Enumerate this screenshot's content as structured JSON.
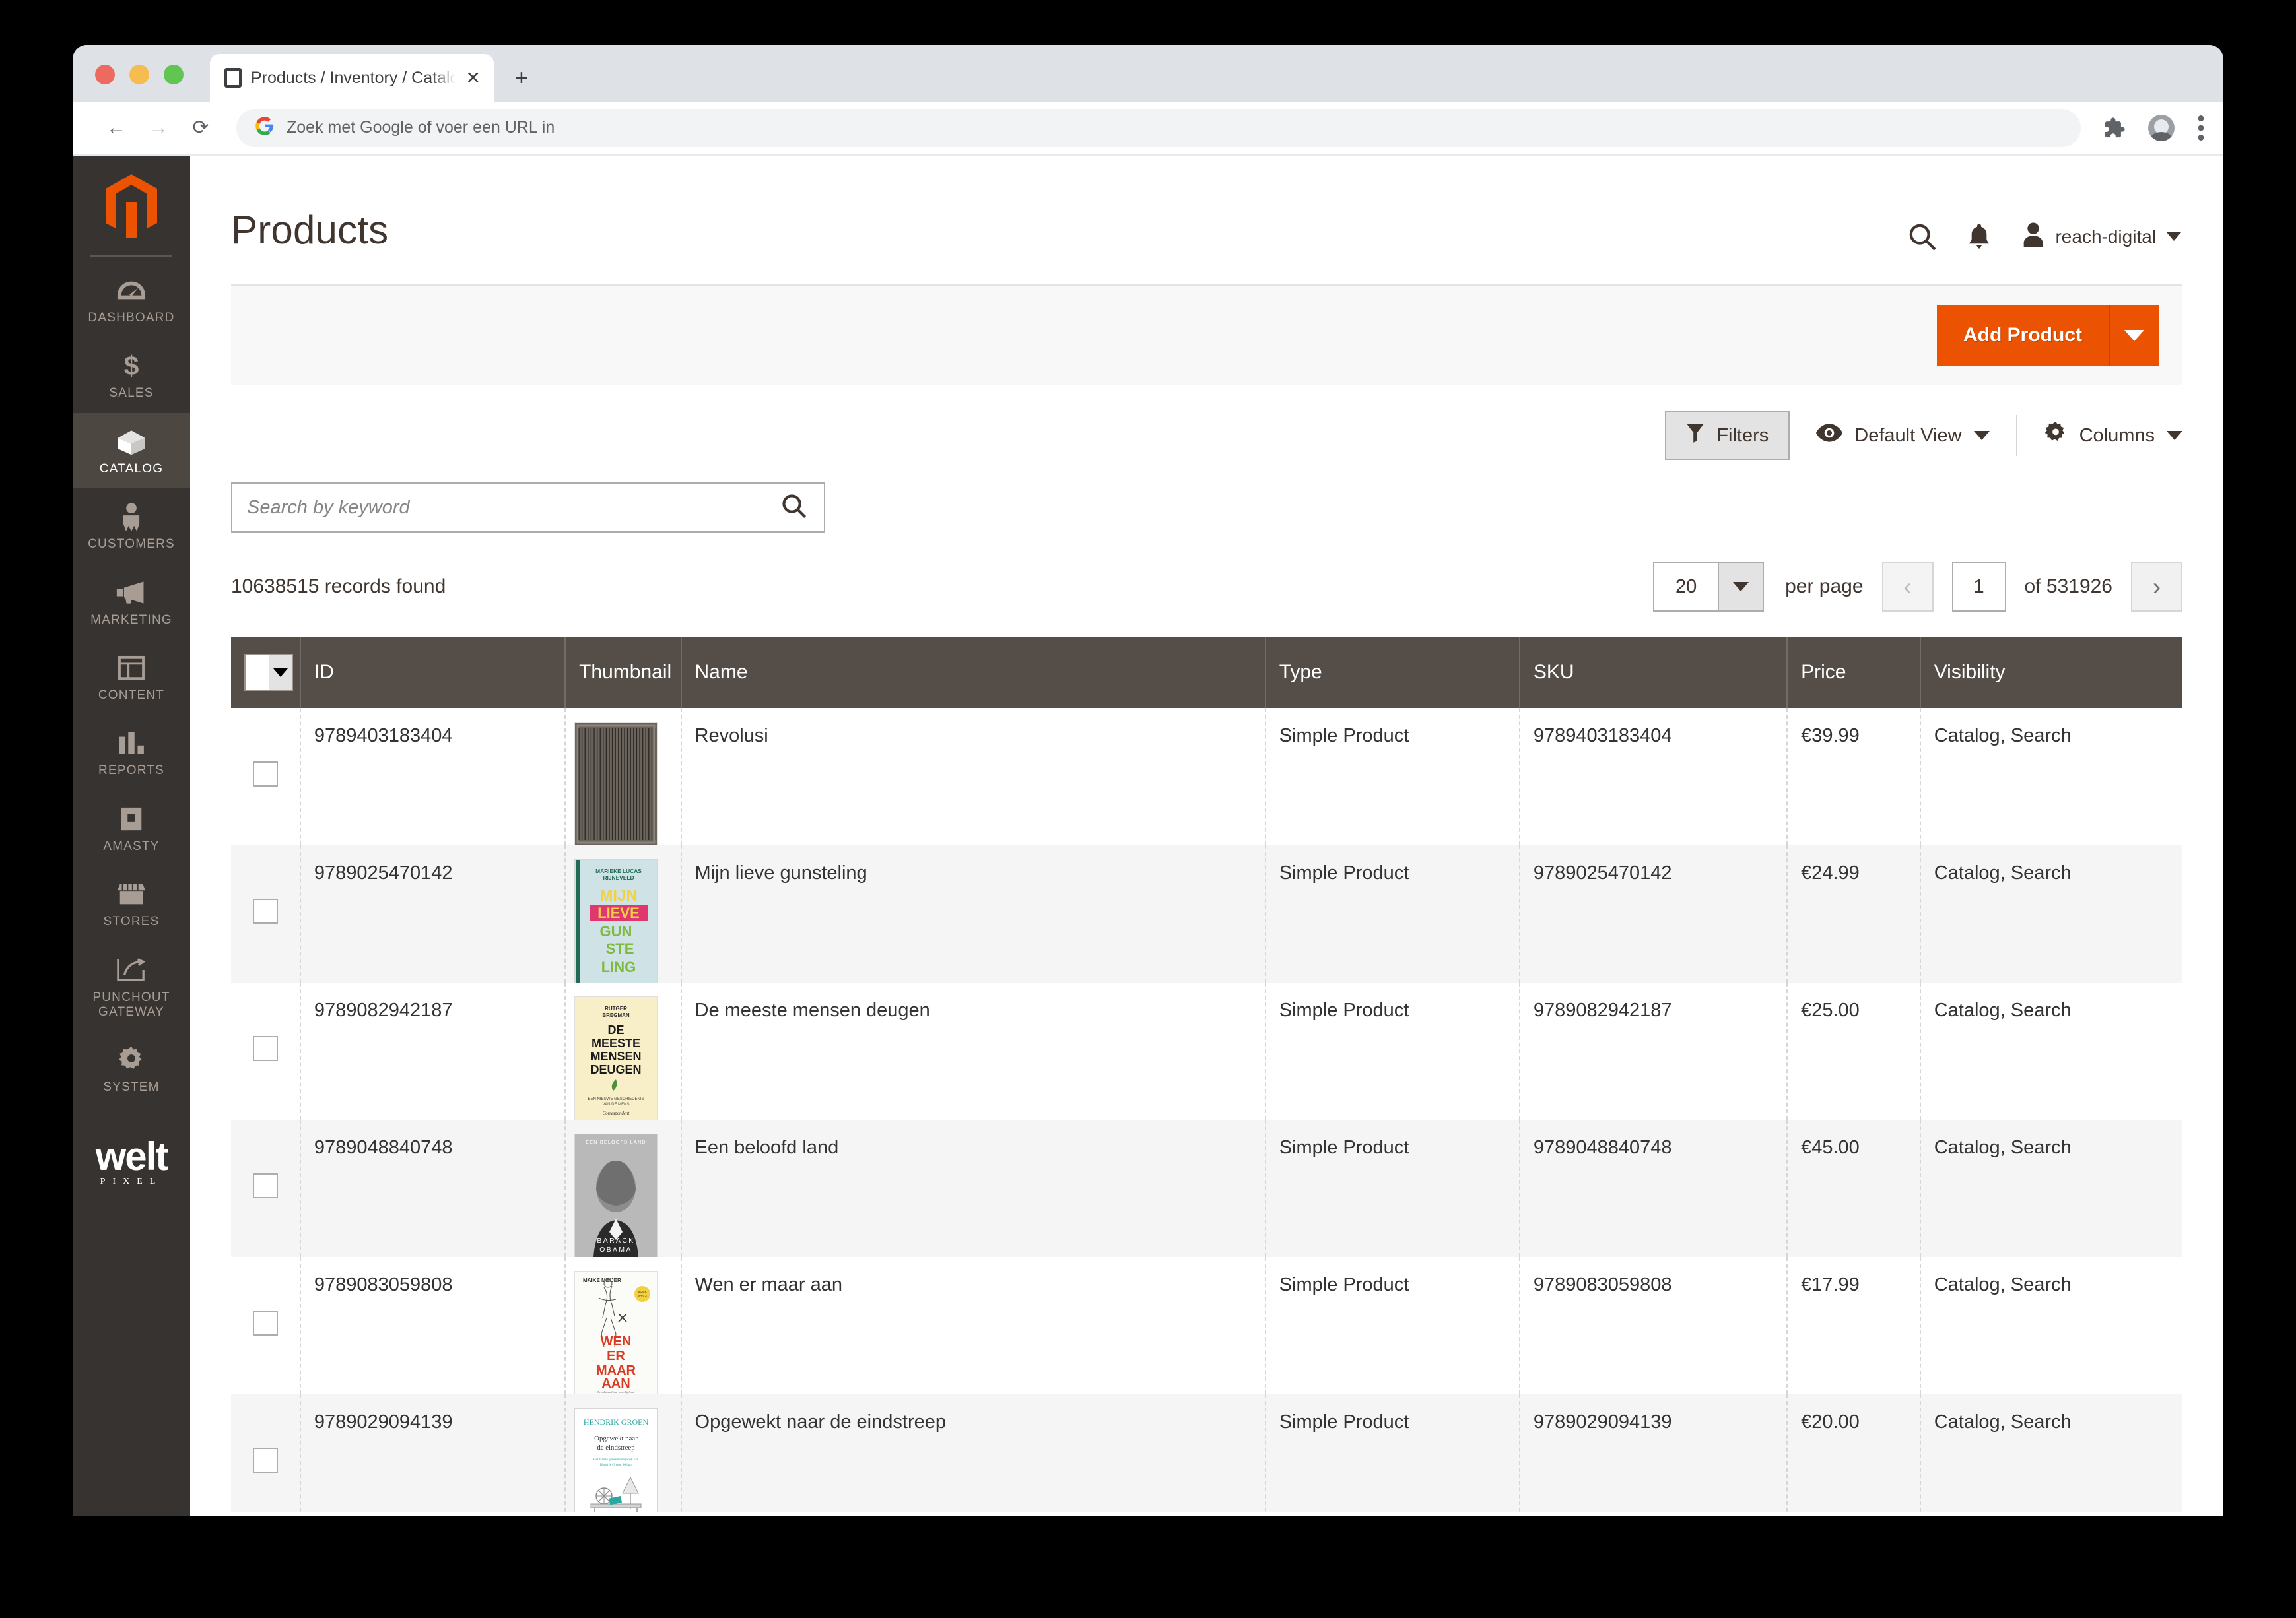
{
  "browser": {
    "tab_title": "Products / Inventory / Catalog /",
    "tab_close_label": "✕",
    "new_tab_label": "+",
    "back_label": "←",
    "forward_label": "→",
    "reload_label": "⟳",
    "url_placeholder": "Zoek met Google of voer een URL in",
    "omni_icons": [
      "extensions-icon",
      "profile-avatar",
      "chrome-menu-icon"
    ]
  },
  "sidebar": {
    "logo": "magento-logo",
    "items": [
      {
        "label": "DASHBOARD",
        "icon": "dashboard-gauge-icon",
        "active": false
      },
      {
        "label": "SALES",
        "icon": "dollar-sign-icon",
        "active": false
      },
      {
        "label": "CATALOG",
        "icon": "box-icon",
        "active": true
      },
      {
        "label": "CUSTOMERS",
        "icon": "person-icon",
        "active": false
      },
      {
        "label": "MARKETING",
        "icon": "megaphone-icon",
        "active": false
      },
      {
        "label": "CONTENT",
        "icon": "layout-icon",
        "active": false
      },
      {
        "label": "REPORTS",
        "icon": "bar-chart-icon",
        "active": false
      },
      {
        "label": "AMASTY",
        "icon": "amasty-a-icon",
        "active": false
      },
      {
        "label": "STORES",
        "icon": "storefront-icon",
        "active": false
      },
      {
        "label": "PUNCHOUT GATEWAY",
        "icon": "punchout-arrow-icon",
        "active": false
      },
      {
        "label": "SYSTEM",
        "icon": "gear-icon",
        "active": false
      }
    ],
    "footer_logo_word": "welt",
    "footer_logo_sub": "PIXEL"
  },
  "header": {
    "title": "Products",
    "user_name": "reach-digital",
    "search_icon": "search-icon",
    "notifications_icon": "bell-icon",
    "user_icon": "user-avatar-icon"
  },
  "action_bar": {
    "add_product_label": "Add Product",
    "add_product_toggle": "chevron-down-icon",
    "accent_color": "#eb5202"
  },
  "grid_toolbar": {
    "filters_label": "Filters",
    "filters_icon": "funnel-icon",
    "view_label": "Default View",
    "view_icon": "eye-icon",
    "columns_label": "Columns",
    "columns_icon": "gear-icon"
  },
  "search": {
    "placeholder": "Search by keyword",
    "value": "",
    "icon": "search-icon"
  },
  "pagination": {
    "records_found": "10638515 records found",
    "per_page_value": "20",
    "per_page_label": "per page",
    "page_value": "1",
    "page_total": "of 531926",
    "prev_label": "‹",
    "next_label": "›"
  },
  "grid": {
    "columns": [
      "ID",
      "Thumbnail",
      "Name",
      "Type",
      "SKU",
      "Price",
      "Visibility"
    ],
    "rows": [
      {
        "id": "9789403183404",
        "name": "Revolusi",
        "type": "Simple Product",
        "sku": "9789403183404",
        "price": "€39.99",
        "visibility": "Catalog, Search",
        "thumbnail": "book-cover-revolusi"
      },
      {
        "id": "9789025470142",
        "name": "Mijn lieve gunsteling",
        "type": "Simple Product",
        "sku": "9789025470142",
        "price": "€24.99",
        "visibility": "Catalog, Search",
        "thumbnail": "book-cover-mijn-lieve-gunsteling"
      },
      {
        "id": "9789082942187",
        "name": "De meeste mensen deugen",
        "type": "Simple Product",
        "sku": "9789082942187",
        "price": "€25.00",
        "visibility": "Catalog, Search",
        "thumbnail": "book-cover-de-meeste-mensen-deugen"
      },
      {
        "id": "9789048840748",
        "name": "Een beloofd land",
        "type": "Simple Product",
        "sku": "9789048840748",
        "price": "€45.00",
        "visibility": "Catalog, Search",
        "thumbnail": "book-cover-een-beloofd-land"
      },
      {
        "id": "9789083059808",
        "name": "Wen er maar aan",
        "type": "Simple Product",
        "sku": "9789083059808",
        "price": "€17.99",
        "visibility": "Catalog, Search",
        "thumbnail": "book-cover-wen-er-maar-aan"
      },
      {
        "id": "9789029094139",
        "name": "Opgewekt naar de eindstreep",
        "type": "Simple Product",
        "sku": "9789029094139",
        "price": "€20.00",
        "visibility": "Catalog, Search",
        "thumbnail": "book-cover-opgewekt-naar-de-eindstreep"
      }
    ]
  }
}
